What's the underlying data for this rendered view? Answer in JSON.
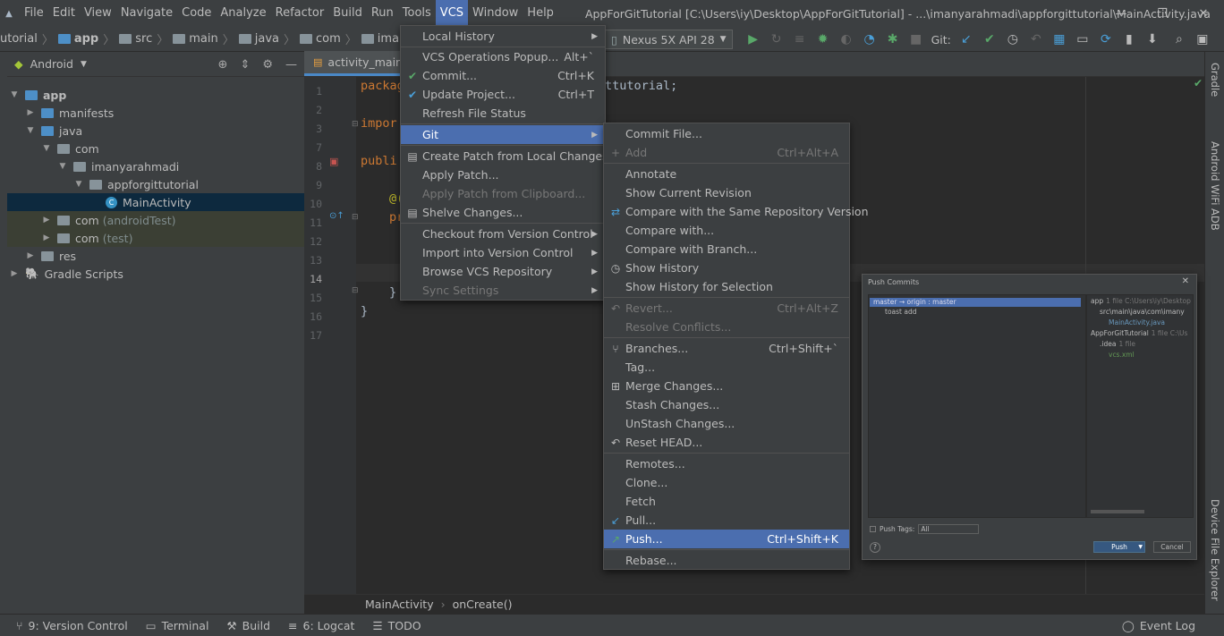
{
  "menubar": {
    "items": [
      "File",
      "Edit",
      "View",
      "Navigate",
      "Code",
      "Analyze",
      "Refactor",
      "Build",
      "Run",
      "Tools",
      "VCS",
      "Window",
      "Help"
    ],
    "active": "VCS",
    "window_title": "AppForGitTutorial [C:\\Users\\iy\\Desktop\\AppForGitTutorial] - ...\\imanyarahmadi\\appforgittutorial\\MainActivity.java"
  },
  "navbar": {
    "crumbs": [
      "utorial",
      "app",
      "src",
      "main",
      "java",
      "com",
      "imanyarahmadi"
    ],
    "device": "Nexus 5X API 28",
    "git_label": "Git:"
  },
  "project": {
    "view_mode": "Android",
    "tree": [
      {
        "label": "app",
        "extra": "",
        "level": 0,
        "open": true,
        "kind": "module"
      },
      {
        "label": "manifests",
        "extra": "",
        "level": 1,
        "open": false,
        "kind": "folder-blue"
      },
      {
        "label": "java",
        "extra": "",
        "level": 1,
        "open": true,
        "kind": "folder-blue"
      },
      {
        "label": "com",
        "extra": "",
        "level": 2,
        "open": true,
        "kind": "package"
      },
      {
        "label": "imanyarahmadi",
        "extra": "",
        "level": 3,
        "open": true,
        "kind": "package"
      },
      {
        "label": "appforgittutorial",
        "extra": "",
        "level": 4,
        "open": true,
        "kind": "package"
      },
      {
        "label": "MainActivity",
        "extra": "",
        "level": 5,
        "open": null,
        "kind": "class"
      },
      {
        "label": "com",
        "extra": "(androidTest)",
        "level": 2,
        "open": false,
        "kind": "package"
      },
      {
        "label": "com",
        "extra": "(test)",
        "level": 2,
        "open": false,
        "kind": "package"
      },
      {
        "label": "res",
        "extra": "",
        "level": 1,
        "open": false,
        "kind": "folder"
      },
      {
        "label": "Gradle Scripts",
        "extra": "",
        "level": 0,
        "open": false,
        "kind": "gradle"
      }
    ]
  },
  "editor": {
    "tab": "activity_main.x",
    "line_numbers": [
      "1",
      "2",
      "3",
      "7",
      "8",
      "9",
      "10",
      "11",
      "12",
      "13",
      "14",
      "15",
      "16",
      "17"
    ],
    "code_line1_kw": "packag",
    "code_line1_rest": "ttutorial;",
    "code_line3": "impor",
    "code_line8": "publi",
    "code_line10": "@(",
    "code_line11": "pr",
    "code_line15": "}",
    "code_line16": "}"
  },
  "bottom_breadcrumb": [
    "MainActivity",
    "onCreate()"
  ],
  "statusbar": {
    "version_control": "9: Version Control",
    "terminal": "Terminal",
    "build": "Build",
    "logcat": "6: Logcat",
    "todo": "TODO",
    "event_log": "Event Log"
  },
  "side_labels": {
    "gradle": "Gradle",
    "wifi_adb": "Android WiFi ADB",
    "device_explorer": "Device File Explorer"
  },
  "vcs_menu": {
    "items": [
      {
        "label": "Local History",
        "shortcut": "",
        "submenu": true,
        "disabled": false,
        "icon": ""
      },
      {
        "label": "VCS Operations Popup...",
        "shortcut": "Alt+`",
        "submenu": false,
        "disabled": false,
        "icon": ""
      },
      {
        "label": "Commit...",
        "shortcut": "Ctrl+K",
        "submenu": false,
        "disabled": false,
        "icon": "check"
      },
      {
        "label": "Update Project...",
        "shortcut": "Ctrl+T",
        "submenu": false,
        "disabled": false,
        "icon": "update"
      },
      {
        "label": "Refresh File Status",
        "shortcut": "",
        "submenu": false,
        "disabled": false,
        "icon": ""
      },
      {
        "label": "Git",
        "shortcut": "",
        "submenu": true,
        "disabled": false,
        "icon": "",
        "highlighted": true
      },
      {
        "label": "Create Patch from Local Changes...",
        "shortcut": "",
        "submenu": false,
        "disabled": false,
        "icon": "patch"
      },
      {
        "label": "Apply Patch...",
        "shortcut": "",
        "submenu": false,
        "disabled": false,
        "icon": ""
      },
      {
        "label": "Apply Patch from Clipboard...",
        "shortcut": "",
        "submenu": false,
        "disabled": true,
        "icon": ""
      },
      {
        "label": "Shelve Changes...",
        "shortcut": "",
        "submenu": false,
        "disabled": false,
        "icon": "shelve"
      },
      {
        "label": "Checkout from Version Control",
        "shortcut": "",
        "submenu": true,
        "disabled": false,
        "icon": ""
      },
      {
        "label": "Import into Version Control",
        "shortcut": "",
        "submenu": true,
        "disabled": false,
        "icon": ""
      },
      {
        "label": "Browse VCS Repository",
        "shortcut": "",
        "submenu": true,
        "disabled": false,
        "icon": ""
      },
      {
        "label": "Sync Settings",
        "shortcut": "",
        "submenu": true,
        "disabled": true,
        "icon": ""
      }
    ]
  },
  "git_menu": {
    "items": [
      {
        "label": "Commit File...",
        "shortcut": "",
        "disabled": false,
        "icon": ""
      },
      {
        "label": "Add",
        "shortcut": "Ctrl+Alt+A",
        "disabled": true,
        "icon": "plus"
      },
      {
        "label": "Annotate",
        "shortcut": "",
        "disabled": false,
        "icon": ""
      },
      {
        "label": "Show Current Revision",
        "shortcut": "",
        "disabled": false,
        "icon": ""
      },
      {
        "label": "Compare with the Same Repository Version",
        "shortcut": "",
        "disabled": false,
        "icon": "compare"
      },
      {
        "label": "Compare with...",
        "shortcut": "",
        "disabled": false,
        "icon": ""
      },
      {
        "label": "Compare with Branch...",
        "shortcut": "",
        "disabled": false,
        "icon": ""
      },
      {
        "label": "Show History",
        "shortcut": "",
        "disabled": false,
        "icon": "clock"
      },
      {
        "label": "Show History for Selection",
        "shortcut": "",
        "disabled": false,
        "icon": ""
      },
      {
        "label": "Revert...",
        "shortcut": "Ctrl+Alt+Z",
        "disabled": true,
        "icon": "revert"
      },
      {
        "label": "Resolve Conflicts...",
        "shortcut": "",
        "disabled": true,
        "icon": ""
      },
      {
        "label": "Branches...",
        "shortcut": "Ctrl+Shift+`",
        "disabled": false,
        "icon": "branch"
      },
      {
        "label": "Tag...",
        "shortcut": "",
        "disabled": false,
        "icon": ""
      },
      {
        "label": "Merge Changes...",
        "shortcut": "",
        "disabled": false,
        "icon": "merge"
      },
      {
        "label": "Stash Changes...",
        "shortcut": "",
        "disabled": false,
        "icon": ""
      },
      {
        "label": "UnStash Changes...",
        "shortcut": "",
        "disabled": false,
        "icon": ""
      },
      {
        "label": "Reset HEAD...",
        "shortcut": "",
        "disabled": false,
        "icon": "reset"
      },
      {
        "label": "Remotes...",
        "shortcut": "",
        "disabled": false,
        "icon": ""
      },
      {
        "label": "Clone...",
        "shortcut": "",
        "disabled": false,
        "icon": ""
      },
      {
        "label": "Fetch",
        "shortcut": "",
        "disabled": false,
        "icon": ""
      },
      {
        "label": "Pull...",
        "shortcut": "",
        "disabled": false,
        "icon": "pull"
      },
      {
        "label": "Push...",
        "shortcut": "Ctrl+Shift+K",
        "disabled": false,
        "icon": "push",
        "highlighted": true
      },
      {
        "label": "Rebase...",
        "shortcut": "",
        "disabled": false,
        "icon": ""
      }
    ]
  },
  "push_dialog": {
    "title": "Push Commits",
    "branch": "master → origin : master",
    "commit": "toast add",
    "files": [
      {
        "label": "app",
        "extra": "1 file C:\\Users\\iy\\Desktop"
      },
      {
        "label": "src\\main\\java\\com\\imany",
        "extra": ""
      },
      {
        "label": "MainActivity.java",
        "extra": ""
      },
      {
        "label": "AppForGitTutorial",
        "extra": "1 file C:\\Us"
      },
      {
        "label": ".idea",
        "extra": "1 file"
      },
      {
        "label": "vcs.xml",
        "extra": ""
      }
    ],
    "push_tags_label": "Push Tags:",
    "push_tags_value": "All",
    "push_button": "Push",
    "cancel_button": "Cancel",
    "help": "?"
  }
}
